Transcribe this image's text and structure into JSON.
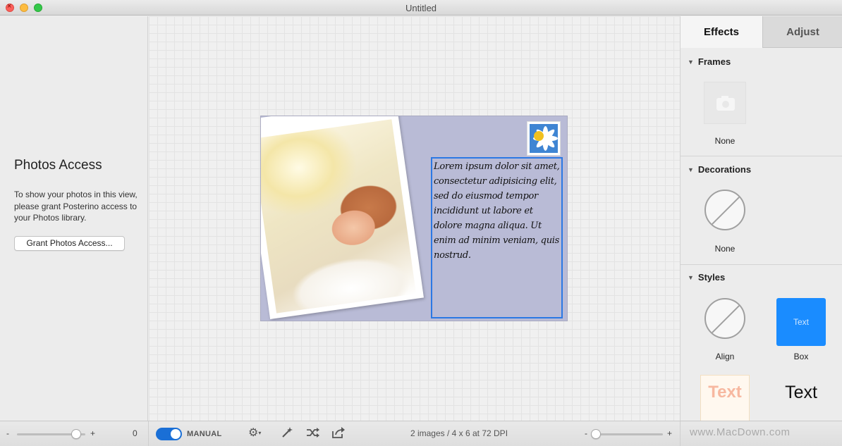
{
  "window": {
    "title": "Untitled"
  },
  "sidebar": {
    "title": "Photos Access",
    "message": "To show your photos in this view, please grant Posterino access to your Photos library.",
    "grant_button": "Grant Photos Access...",
    "zoom_minus": "-",
    "zoom_plus": "+",
    "zoom_value": "0"
  },
  "postcard": {
    "text": "Lorem ipsum dolor sit amet, consectetur adipisicing elit, sed do eiusmod tempor incididunt ut labore et dolore magna aliqua. Ut enim ad minim veniam, quis nostrud.",
    "background_color": "#b9bbd6",
    "selection_color": "#2b78e4"
  },
  "panel": {
    "tabs": [
      {
        "label": "Effects",
        "active": true
      },
      {
        "label": "Adjust",
        "active": false
      }
    ],
    "sections": {
      "frames": {
        "title": "Frames",
        "items": [
          {
            "label": "None",
            "icon": "camera-icon"
          }
        ]
      },
      "decorations": {
        "title": "Decorations",
        "items": [
          {
            "label": "None",
            "icon": "none-icon"
          }
        ]
      },
      "styles": {
        "title": "Styles",
        "items": [
          {
            "label": "Align",
            "icon": "none-icon"
          },
          {
            "label": "Box",
            "preview_text": "Text"
          },
          {
            "preview_text": "Text"
          },
          {
            "preview_text": "Text"
          }
        ]
      }
    }
  },
  "toolbar": {
    "mode_label": "MANUAL",
    "mode_on": true,
    "status": "2 images / 4 x 6 at 72 DPI",
    "zoom_minus": "-",
    "zoom_plus": "+",
    "watermark": "www.MacDown.com",
    "icons": [
      "gear-icon",
      "magic-wand-icon",
      "shuffle-icon",
      "share-icon"
    ]
  },
  "colors": {
    "accent": "#1a6fd6",
    "box_style": "#1a8cff"
  }
}
